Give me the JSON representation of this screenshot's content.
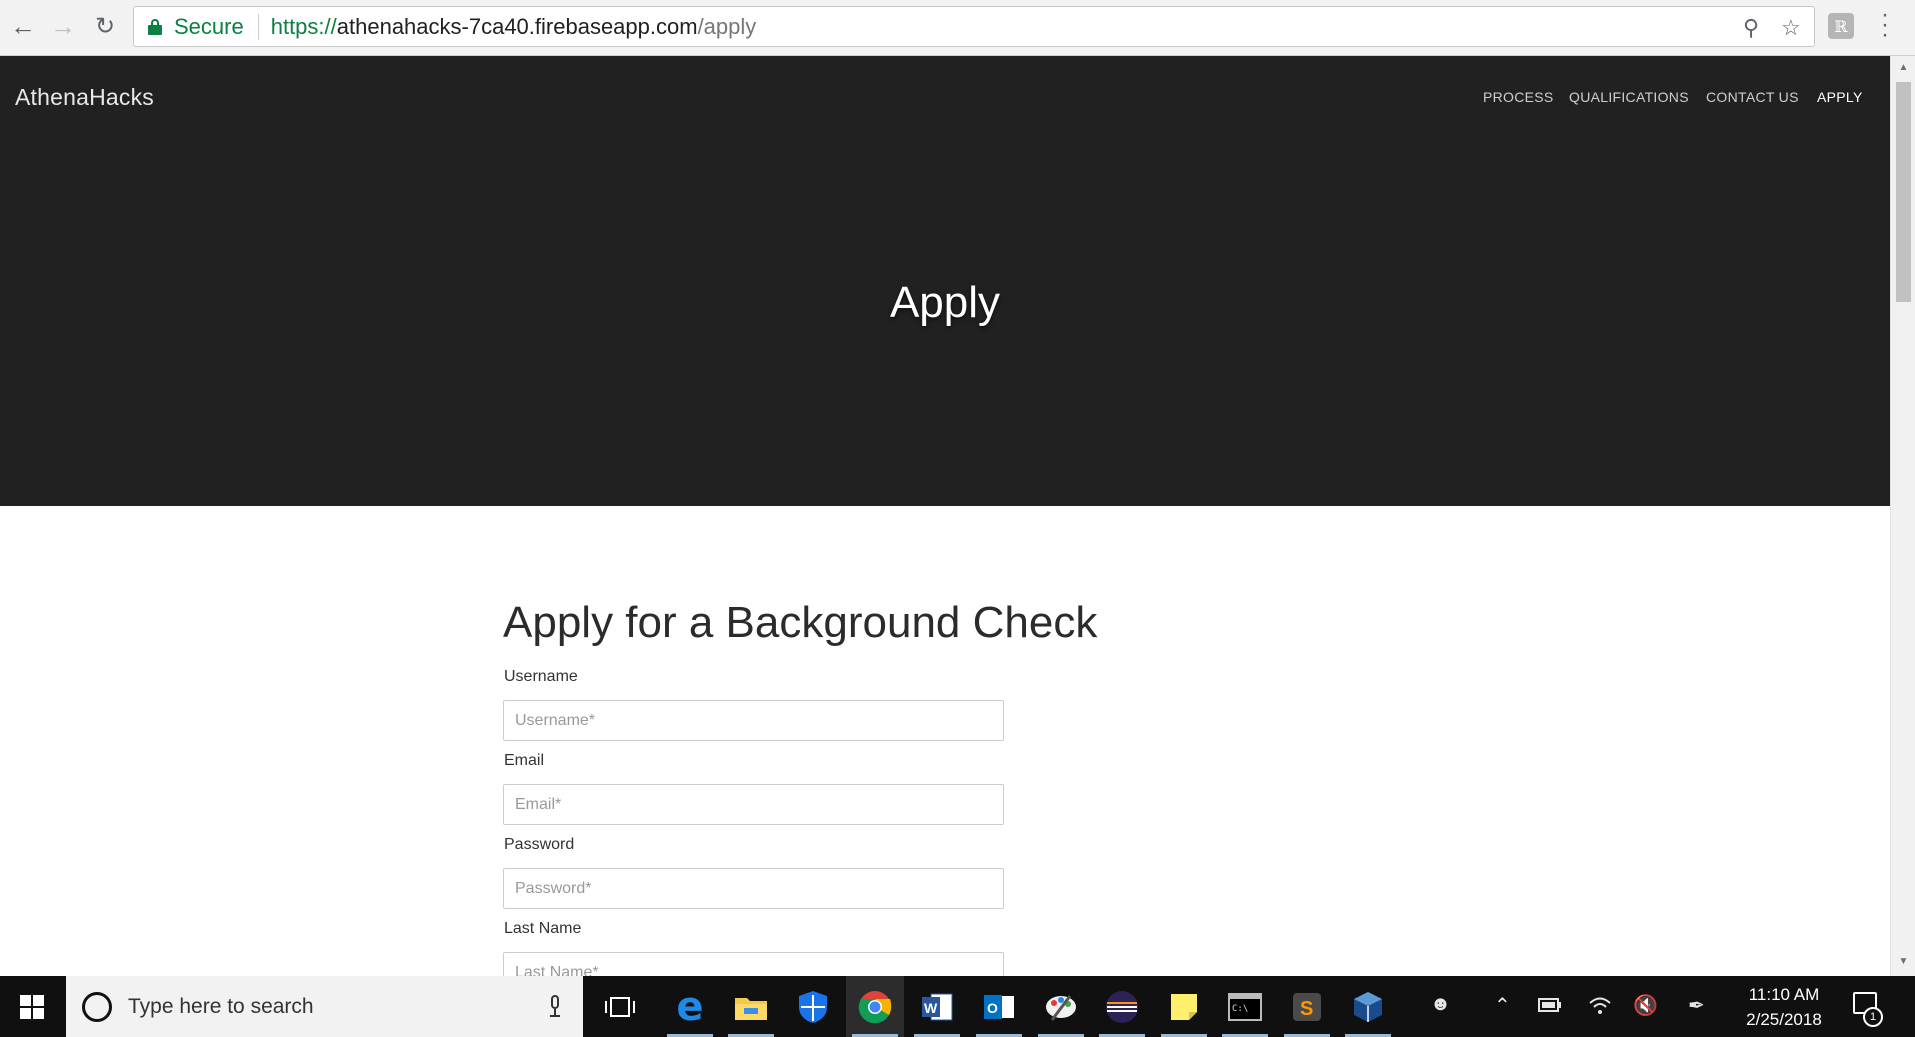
{
  "browser": {
    "secure_label": "Secure",
    "url_scheme": "https://",
    "url_host": "athenahacks-7ca40.firebaseapp.com",
    "url_path": "/apply",
    "ext_label": "ℝ"
  },
  "site": {
    "brand": "AthenaHacks",
    "nav": [
      "PROCESS",
      "QUALIFICATIONS",
      "CONTACT US",
      "APPLY"
    ],
    "hero_title": "Apply"
  },
  "form": {
    "title": "Apply for a Background Check",
    "fields": [
      {
        "label": "Username",
        "placeholder": "Username*"
      },
      {
        "label": "Email",
        "placeholder": "Email*"
      },
      {
        "label": "Password",
        "placeholder": "Password*"
      },
      {
        "label": "Last Name",
        "placeholder": "Last Name*"
      }
    ]
  },
  "taskbar": {
    "search_placeholder": "Type here to search",
    "time": "11:10 AM",
    "date": "2/25/2018",
    "notification_count": "1",
    "apps": [
      "task-view",
      "edge",
      "file-explorer",
      "windows-defender",
      "chrome",
      "word",
      "outlook",
      "paint",
      "eclipse",
      "sticky-notes",
      "command-prompt",
      "sublime-text",
      "virtualbox"
    ]
  },
  "colors": {
    "hero_bg": "#212121",
    "secure_green": "#0b8043",
    "taskbar_bg": "#101010"
  }
}
